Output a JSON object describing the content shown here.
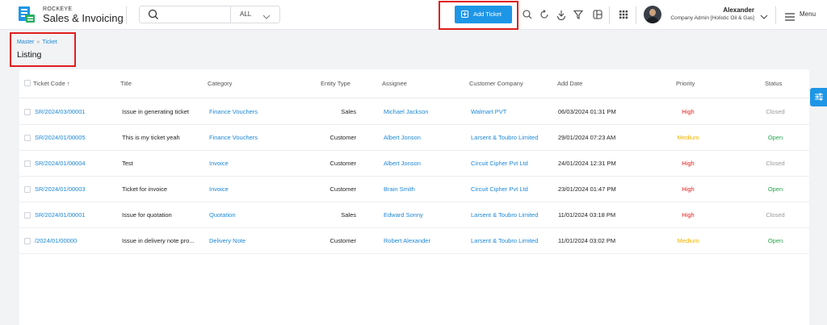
{
  "brand": {
    "small": "ROCKEYE",
    "name": "Sales & Invoicing"
  },
  "search": {
    "placeholder": "",
    "scope": "ALL"
  },
  "header": {
    "add_ticket_label": "Add Ticket",
    "user_name": "Alexander",
    "user_role": "Company Admin [Holistic Oil & Gas]",
    "menu_label": "Menu",
    "tool_icons": [
      "search-icon",
      "refresh-icon",
      "download-icon",
      "filter-icon",
      "columns-icon",
      "apps-grid-icon"
    ]
  },
  "breadcrumb": {
    "items": [
      "Master",
      "Ticket"
    ]
  },
  "page_title": "Listing",
  "table": {
    "columns": [
      "Ticket Code",
      "Title",
      "Category",
      "Entity Type",
      "Assignee",
      "Customer Company",
      "Add Date",
      "Priority",
      "Status"
    ],
    "sort_indicator": "↑",
    "rows": [
      {
        "code": "SR/2024/03/00001",
        "title": "Issue in generating ticket",
        "category": "Finance Vouchers",
        "entity": "Sales",
        "assignee": "Michael Jackson",
        "company": "Walmart PVT",
        "date": "06/03/2024 01:31 PM",
        "priority": "High",
        "status": "Closed"
      },
      {
        "code": "SR/2024/01/00005",
        "title": "This is my ticket yeah",
        "category": "Finance Vouchers",
        "entity": "Customer",
        "assignee": "Albert Jonson",
        "company": "Larsent & Toubro Limited",
        "date": "29/01/2024 07:23 AM",
        "priority": "Medium",
        "status": "Open"
      },
      {
        "code": "SR/2024/01/00004",
        "title": "Test",
        "category": "Invoice",
        "entity": "Customer",
        "assignee": "Albert Jonson",
        "company": "Circuit Cipher Pvt Ltd",
        "date": "24/01/2024 12:31 PM",
        "priority": "High",
        "status": "Closed"
      },
      {
        "code": "SR/2024/01/00003",
        "title": "Ticket for invoice",
        "category": "Invoice",
        "entity": "Customer",
        "assignee": "Brain Smith",
        "company": "Circuit Cipher Pvt Ltd",
        "date": "23/01/2024 01:47 PM",
        "priority": "High",
        "status": "Open"
      },
      {
        "code": "SR/2024/01/00001",
        "title": "Issue for quotation",
        "category": "Quotation",
        "entity": "Sales",
        "assignee": "Edward Sonny",
        "company": "Larsent & Toubro Limited",
        "date": "11/01/2024 03:18 PM",
        "priority": "High",
        "status": "Closed"
      },
      {
        "code": "/2024/01/00000",
        "title": "Issue in delivery note pro...",
        "category": "Delivery Note",
        "entity": "Customer",
        "assignee": "Robert Alexander",
        "company": "Larsent & Toubro Limited",
        "date": "11/01/2024 03:02 PM",
        "priority": "Medium",
        "status": "Open"
      }
    ]
  },
  "colors": {
    "accent": "#1e96e6",
    "link": "#1e88d6",
    "high": "#e01e1e",
    "medium": "#f2b200",
    "open": "#22a84a",
    "closed": "#9a9a9a",
    "highlight_box": "#e01e1e"
  }
}
